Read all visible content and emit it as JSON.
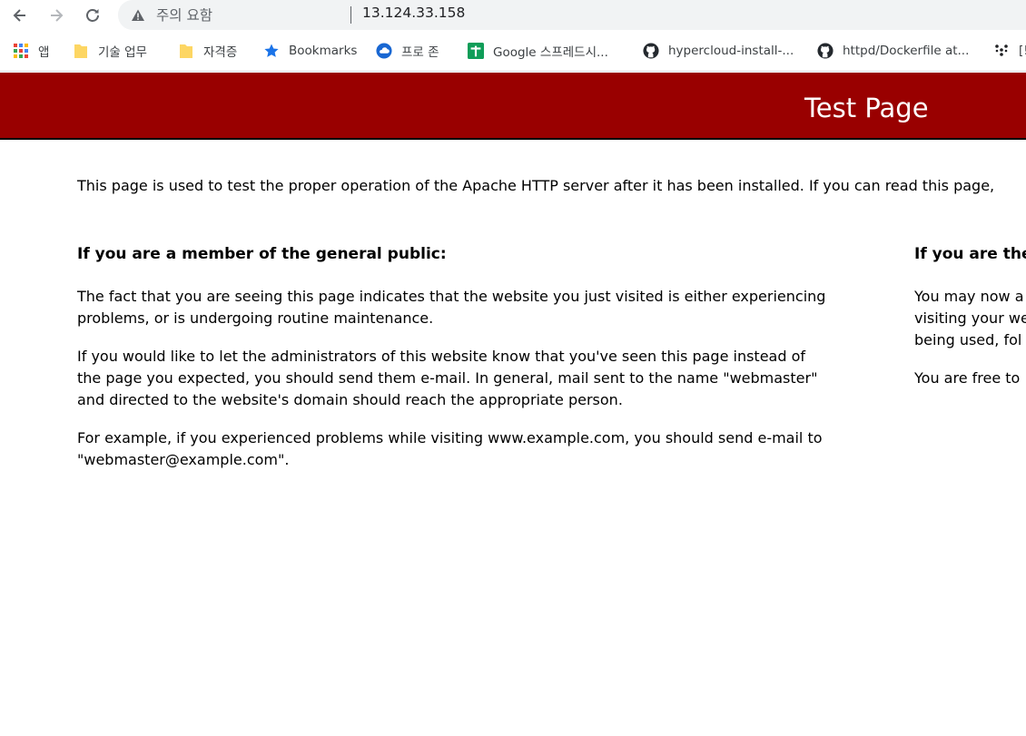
{
  "browser": {
    "security_label": "주의 요함",
    "url": "13.124.33.158",
    "bookmarks": [
      {
        "label": "앱",
        "icon": "apps-grid-icon"
      },
      {
        "label": "기술 업무",
        "icon": "folder-icon"
      },
      {
        "label": "자격증",
        "icon": "folder-icon"
      },
      {
        "label": "Bookmarks",
        "icon": "star-icon"
      },
      {
        "label": "프로 존",
        "icon": "cloud-icon"
      },
      {
        "label": "Google 스프레드시...",
        "icon": "sheets-icon"
      },
      {
        "label": "hypercloud-install-...",
        "icon": "github-icon"
      },
      {
        "label": "httpd/Dockerfile at...",
        "icon": "github-icon"
      },
      {
        "label": "[!",
        "icon": "dots-icon"
      }
    ]
  },
  "page": {
    "banner_title": "Test Page",
    "intro": "This page is used to test the proper operation of the Apache HTTP server after it has been installed. If you can read this page,",
    "left": {
      "heading": "If you are a member of the general public:",
      "paragraphs": [
        "The fact that you are seeing this page indicates that the website you just visited is either experiencing problems, or is undergoing routine maintenance.",
        "If you would like to let the administrators of this website know that you've seen this page instead of the page you expected, you should send them e-mail. In general, mail sent to the name \"webmaster\" and directed to the website's domain should reach the appropriate person.",
        "For example, if you experienced problems while visiting www.example.com, you should send e-mail to \"webmaster@example.com\"."
      ]
    },
    "right": {
      "heading": "If you are the",
      "lines": [
        "You may now a",
        "visiting your we",
        "being used, fol"
      ],
      "line2": "You are free to"
    }
  }
}
